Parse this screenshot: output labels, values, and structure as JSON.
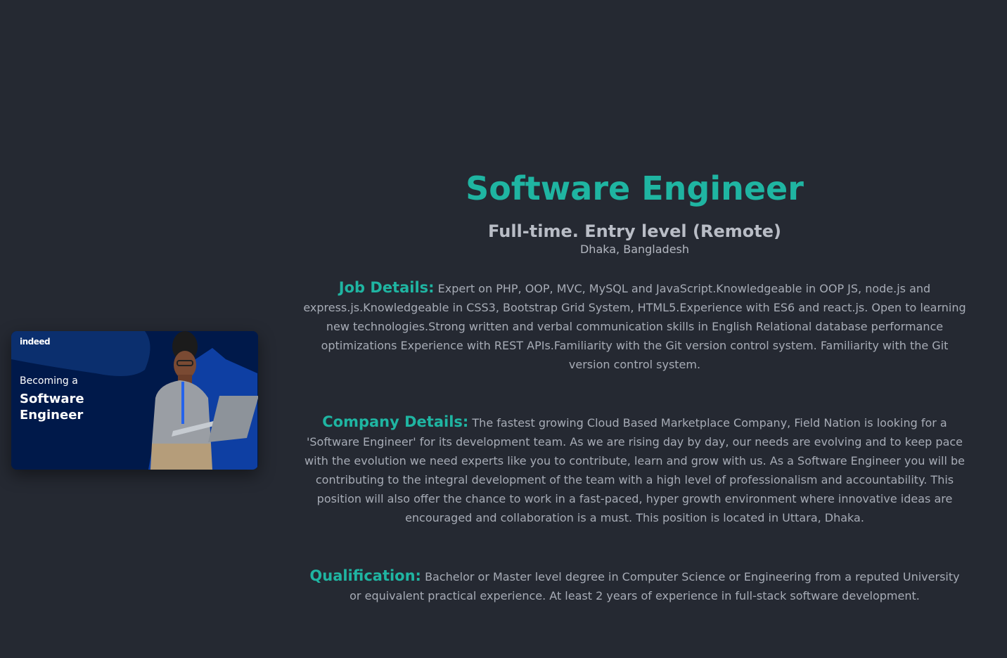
{
  "banner": {
    "brand": "indeed",
    "pre_title": "Becoming a",
    "title": "Software Engineer",
    "image_desc": "person-with-laptop-illustration"
  },
  "job": {
    "title": "Software Engineer",
    "type": "Full-time. Entry level (Remote)",
    "location": "Dhaka, Bangladesh"
  },
  "sections": {
    "job_details": {
      "label": "Job Details:",
      "text": "Expert on PHP, OOP, MVC, MySQL and JavaScript.Knowledgeable in OOP JS, node.js and express.js.Knowledgeable in CSS3, Bootstrap Grid System, HTML5.Experience with ES6 and react.js. Open to learning new technologies.Strong written and verbal communication skills in English Relational database performance optimizations Experience with REST APIs.Familiarity with the Git version control system. Familiarity with the Git version control system."
    },
    "company_details": {
      "label": "Company Details:",
      "text": "The fastest growing Cloud Based Marketplace Company, Field Nation is looking for a 'Software Engineer' for its development team. As we are rising day by day, our needs are evolving and to keep pace with the evolution we need experts like you to contribute, learn and grow with us. As a Software Engineer you will be contributing to the integral development of the team with a high level of professionalism and accountability. This position will also offer the chance to work in a fast-paced, hyper growth environment where innovative ideas are encouraged and collaboration is a must. This position is located in Uttara, Dhaka."
    },
    "qualification": {
      "label": "Qualification:",
      "text": "Bachelor or Master level degree in Computer Science or Engineering from a reputed University or equivalent practical experience. At least 2 years of experience in full-stack software development."
    }
  },
  "colors": {
    "background": "#252932",
    "accent": "#1fb5a2",
    "body_text": "#a7acb6",
    "banner_bg": "#00194a"
  }
}
